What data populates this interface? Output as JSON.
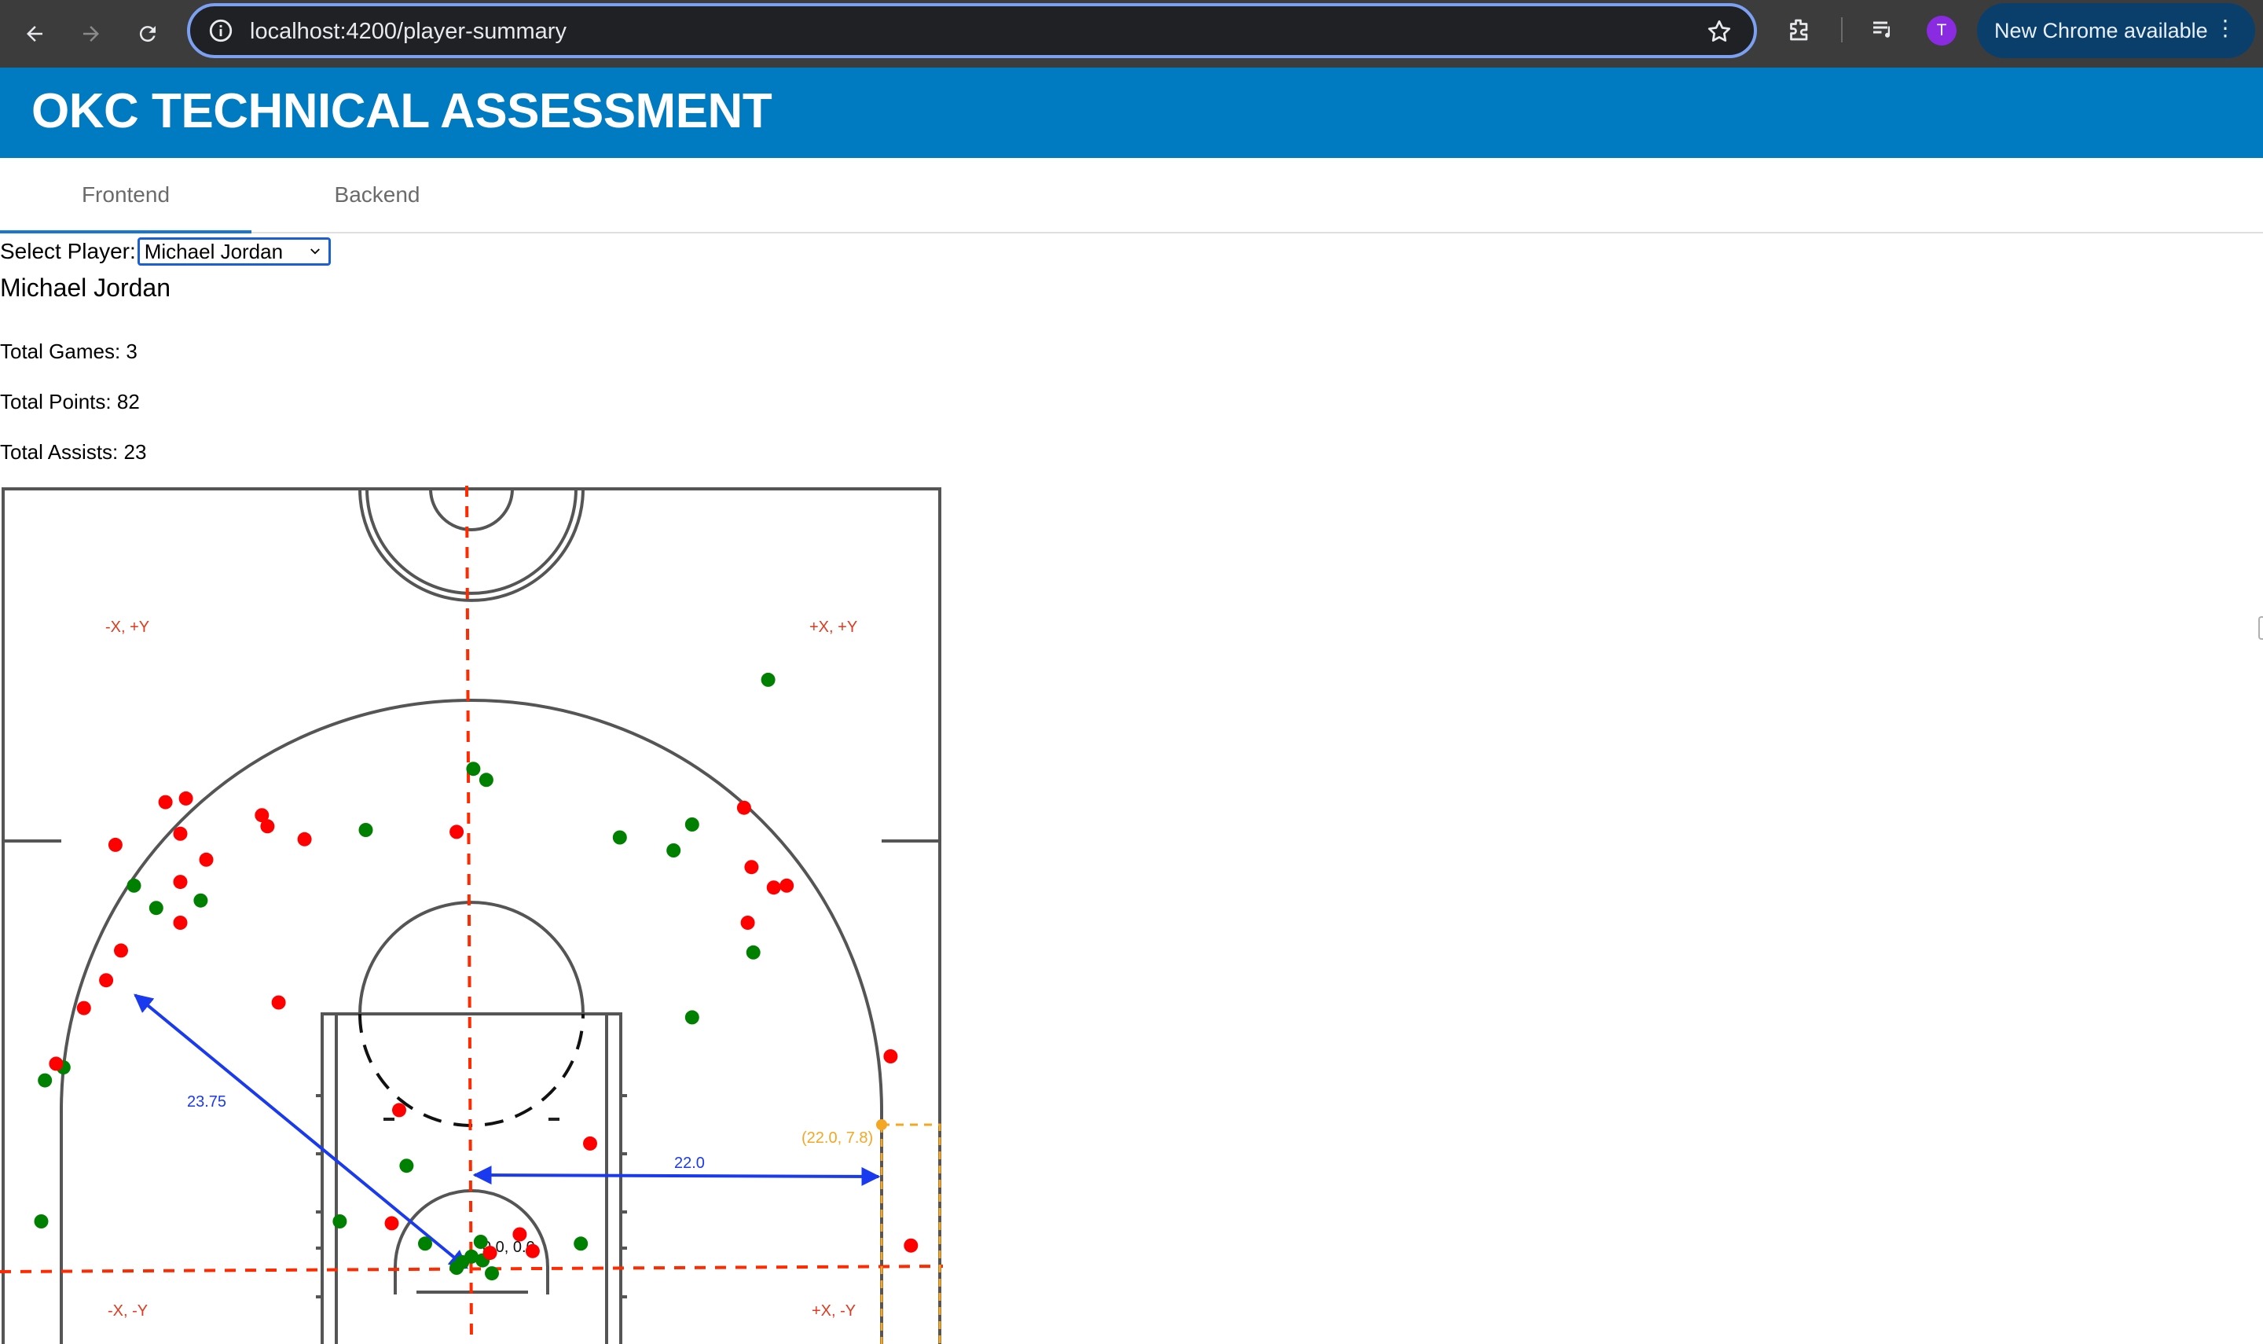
{
  "browser": {
    "url": "localhost:4200/player-summary",
    "update_label": "New Chrome available",
    "profile_initial": "T"
  },
  "app": {
    "title": "OKC TECHNICAL ASSESSMENT"
  },
  "tabs": [
    {
      "label": "Frontend",
      "active": true
    },
    {
      "label": "Backend",
      "active": false
    }
  ],
  "player_select": {
    "label": "Select Player:",
    "selected": "Michael Jordan"
  },
  "player": {
    "name": "Michael Jordan",
    "total_games_label": "Total Games: 3",
    "total_points_label": "Total Points: 82",
    "total_assists_label": "Total Assists: 23"
  },
  "court": {
    "quadrant_labels": {
      "top_left": "-X, +Y",
      "top_right": "+X, +Y",
      "bottom_left": "-X, -Y",
      "bottom_right": "+X, -Y"
    },
    "annotations": {
      "three_radius": "23.75",
      "corner_distance": "22.0",
      "corner_point": "(22.0, 7.8)",
      "origin": "0.0, 0.0"
    },
    "colors": {
      "made": "#008000",
      "missed": "#ff0000",
      "axis": "#ff2a00",
      "measure": "#1a3af0",
      "corner": "#f5a623",
      "label": "#e03a1e"
    }
  },
  "chart_data": {
    "type": "scatter",
    "xlim": [
      -25,
      25
    ],
    "ylim": [
      -4,
      43
    ],
    "series": [
      {
        "name": "made",
        "points": [
          [
            16.0,
            31.7
          ],
          [
            0.1,
            26.9
          ],
          [
            0.8,
            26.3
          ],
          [
            8.0,
            23.2
          ],
          [
            10.9,
            22.5
          ],
          [
            11.9,
            23.9
          ],
          [
            -5.7,
            23.6
          ],
          [
            -18.2,
            20.6
          ],
          [
            -17.0,
            19.4
          ],
          [
            -14.6,
            19.8
          ],
          [
            15.2,
            17.0
          ],
          [
            11.9,
            13.5
          ],
          [
            -22.0,
            10.8
          ],
          [
            -23.0,
            10.1
          ],
          [
            -3.5,
            5.5
          ],
          [
            -7.1,
            2.5
          ],
          [
            -23.2,
            2.5
          ],
          [
            -2.5,
            1.3
          ],
          [
            0.5,
            1.4
          ],
          [
            5.9,
            1.3
          ],
          [
            -0.5,
            0.3
          ],
          [
            0.0,
            0.6
          ],
          [
            0.6,
            0.4
          ],
          [
            1.1,
            -0.3
          ],
          [
            -0.8,
            0.0
          ]
        ]
      },
      {
        "name": "missed",
        "points": [
          [
            -16.5,
            25.1
          ],
          [
            -15.4,
            25.3
          ],
          [
            -11.3,
            24.4
          ],
          [
            -11.0,
            23.8
          ],
          [
            -9.0,
            23.1
          ],
          [
            -0.8,
            23.5
          ],
          [
            14.7,
            24.8
          ],
          [
            -19.2,
            22.8
          ],
          [
            -15.7,
            23.4
          ],
          [
            -14.3,
            22.0
          ],
          [
            -15.7,
            20.8
          ],
          [
            15.1,
            21.6
          ],
          [
            16.3,
            20.5
          ],
          [
            17.0,
            20.6
          ],
          [
            -15.7,
            18.6
          ],
          [
            14.9,
            18.6
          ],
          [
            -18.9,
            17.1
          ],
          [
            -19.7,
            15.5
          ],
          [
            -20.9,
            14.0
          ],
          [
            -10.4,
            14.3
          ],
          [
            -22.4,
            11.0
          ],
          [
            22.6,
            11.4
          ],
          [
            -3.9,
            8.5
          ],
          [
            6.4,
            6.7
          ],
          [
            23.7,
            1.2
          ],
          [
            -4.3,
            2.4
          ],
          [
            2.6,
            1.8
          ],
          [
            3.3,
            0.9
          ],
          [
            1.0,
            0.8
          ]
        ]
      }
    ]
  }
}
